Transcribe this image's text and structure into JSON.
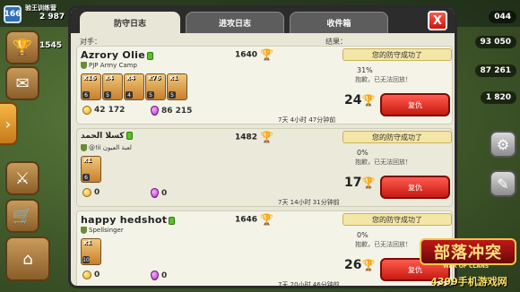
{
  "hud": {
    "player_level": "166",
    "player_name": "验王训练营",
    "gold_left": "2 987",
    "trophies_left": "1545",
    "right_res_1": "044",
    "right_res_2": "93 050",
    "right_res_3": "87 261",
    "right_res_4": "1 820"
  },
  "tabs": {
    "defense_log": "防守日志",
    "attack_log": "进攻日志",
    "inbox": "收件箱"
  },
  "close_label": "X",
  "headers": {
    "opponent": "对手：",
    "result": "结果："
  },
  "entries": [
    {
      "name": "Azrory Olie",
      "clan": "PJP Army Camp",
      "trophies": "1640",
      "troops": [
        {
          "count": "x16",
          "level": "6"
        },
        {
          "count": "x4",
          "level": "5"
        },
        {
          "count": "x4",
          "level": "4"
        },
        {
          "count": "x76",
          "level": "5"
        },
        {
          "count": "x1",
          "level": "5"
        }
      ],
      "gold": "42 172",
      "elixir": "86 215",
      "time": "7天 4小时 47分钟前",
      "result_text": "您的防守成功了",
      "percent": "31%",
      "note": "抱歉，已无法回放！",
      "trophy_change": "24",
      "replay_label": "复仇"
    },
    {
      "name": "كسلا الحمد",
      "clan": "@!ii لعبة العيون",
      "trophies": "1482",
      "troops": [
        {
          "count": "x1",
          "level": "6"
        }
      ],
      "gold": "0",
      "elixir": "0",
      "time": "7天 14小时 31分钟前",
      "result_text": "您的防守成功了",
      "percent": "0%",
      "note": "抱歉，已无法回放！",
      "trophy_change": "17",
      "replay_label": "复仇"
    },
    {
      "name": "happy hedshot",
      "clan": "Spellsinger",
      "trophies": "1646",
      "troops": [
        {
          "count": "x1",
          "level": "10"
        }
      ],
      "gold": "0",
      "elixir": "0",
      "time": "7天 20小时 46分钟前",
      "result_text": "您的防守成功了",
      "percent": "0%",
      "note": "抱歉，已无法回放！",
      "trophy_change": "26",
      "replay_label": "复仇"
    }
  ],
  "logo": {
    "main": "部落冲突",
    "sub": "WAR OF CLANS",
    "site": "4399手机游戏网"
  },
  "colors": {
    "replay_button": "#d9261a",
    "result_banner": "#f4e6a6",
    "panel_bg": "#e8e6d6"
  }
}
